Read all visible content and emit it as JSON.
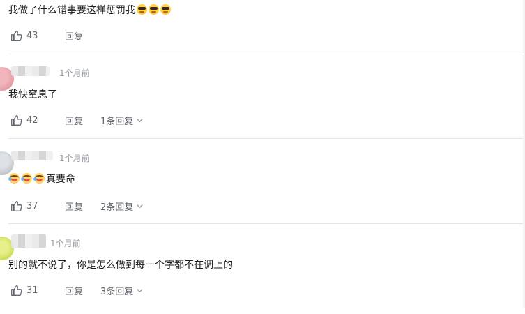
{
  "comments": [
    {
      "time": "",
      "text": "我做了什么错事要这样惩罚我",
      "emoji_after": [
        "cool-sunglasses-emoji",
        "cool-sunglasses-emoji",
        "cool-sunglasses-emoji"
      ],
      "likes": "43",
      "reply_label": "回复",
      "replies_label": ""
    },
    {
      "time": "1个月前",
      "text": "我快窒息了",
      "likes": "42",
      "reply_label": "回复",
      "replies_label": "1条回复"
    },
    {
      "time": "1个月前",
      "text": "真要命",
      "emoji_before": [
        "laugh-cry-emoji",
        "laugh-cry-emoji",
        "laugh-cry-emoji"
      ],
      "likes": "37",
      "reply_label": "回复",
      "replies_label": "2条回复"
    },
    {
      "time": "1个月前",
      "text": "别的就不说了，你是怎么做到每一个字都不在调上的",
      "likes": "31",
      "reply_label": "回复",
      "replies_label": "3条回复"
    }
  ],
  "colors": {
    "text": "#18191c",
    "muted": "#61666d",
    "time": "#9499a0",
    "divider": "#e3e5e7",
    "avatar_2": "#e4a1a8",
    "avatar_3": "#bcc1c6",
    "avatar_4": "#c7db4a"
  },
  "icons": {
    "like": "thumbs-up-icon",
    "expand": "chevron-down-icon"
  }
}
